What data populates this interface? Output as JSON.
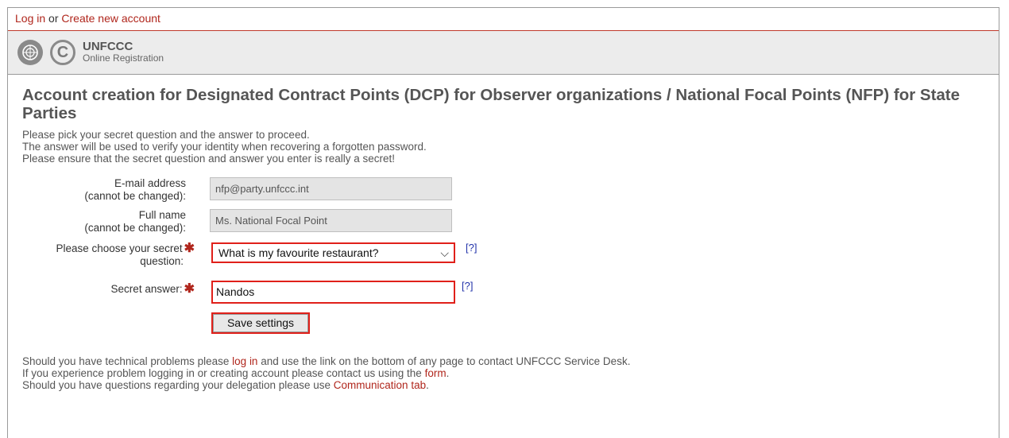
{
  "topbar": {
    "login_link": "Log in",
    "separator": " or ",
    "create_link": "Create new account"
  },
  "brand": {
    "name": "UNFCCC",
    "subtitle": "Online Registration",
    "cc_glyph": "C"
  },
  "title": "Account creation for Designated Contract Points (DCP) for Observer organizations / National Focal Points (NFP) for State Parties",
  "intro": [
    "Please pick your secret question and the answer to proceed.",
    "The answer will be used to verify your identity when recovering a forgotten password.",
    "Please ensure that the secret question and answer you enter is really a secret!"
  ],
  "form": {
    "email_label_1": "E-mail address",
    "email_label_2": "(cannot be changed):",
    "email_value": "nfp@party.unfccc.int",
    "name_label_1": "Full name",
    "name_label_2": "(cannot be changed):",
    "name_value": "Ms. National Focal Point",
    "question_label_1": "Please choose your secret",
    "question_label_2": "question:",
    "question_value": "What is my favourite restaurant?",
    "answer_label": "Secret answer:",
    "answer_value": "Nandos",
    "required_mark": "✱",
    "help_text": "[?]",
    "chevron": "⌵",
    "save_label": "Save settings"
  },
  "footer": {
    "line1_pre": "Should you have technical problems please ",
    "line1_link": "log in",
    "line1_post": " and use the link on the bottom of any page to contact UNFCCC Service Desk.",
    "line2_pre": "If you experience problem logging in or creating account please contact us using the ",
    "line2_link": "form",
    "line2_post": ".",
    "line3_pre": "Should you have questions regarding your delegation please use ",
    "line3_link": "Communication tab",
    "line3_post": "."
  },
  "colors": {
    "accent": "#b0261c",
    "highlight": "#e0201a",
    "help_link": "#2233aa"
  }
}
